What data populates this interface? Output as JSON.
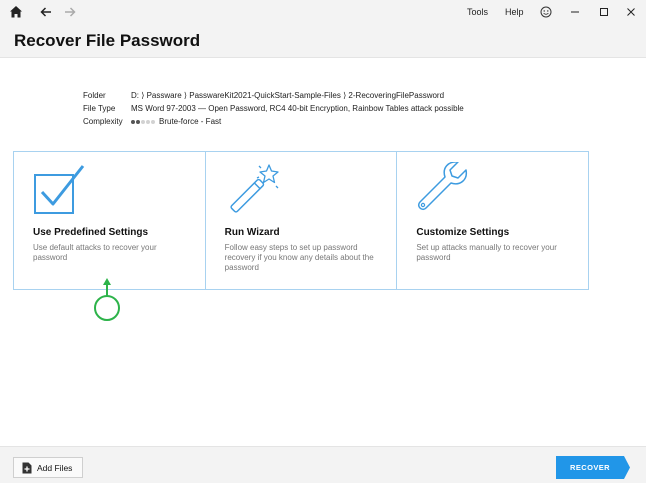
{
  "menu": {
    "tools": "Tools",
    "help": "Help"
  },
  "page": {
    "title": "Recover File Password"
  },
  "file_info": {
    "folder_label": "Folder",
    "folder_value": "D: ⟩ Passware ⟩ PasswareKit2021-QuickStart-Sample-Files ⟩ 2-RecoveringFilePassword",
    "filetype_label": "File Type",
    "filetype_value": "MS Word 97-2003 — Open Password, RC4 40-bit Encryption, Rainbow Tables attack possible",
    "complexity_label": "Complexity",
    "complexity_value": "Brute-force - Fast",
    "complexity_level": 2,
    "complexity_max": 5
  },
  "options": [
    {
      "icon": "checkbox-check-icon",
      "title": "Use Predefined Settings",
      "description": "Use default attacks to recover your password"
    },
    {
      "icon": "magic-wand-icon",
      "title": "Run Wizard",
      "description": "Follow easy steps to set up password recovery if you know any details about the password"
    },
    {
      "icon": "wrench-icon",
      "title": "Customize Settings",
      "description": "Set up attacks manually to recover your password"
    }
  ],
  "footer": {
    "add_files_label": "Add Files",
    "recover_label": "RECOVER"
  },
  "colors": {
    "accent": "#2196e8",
    "icon_blue": "#3d9be0",
    "card_border": "#a8d2f0",
    "pointer_green": "#2db34a",
    "chrome_bg": "#f3f3f3"
  }
}
